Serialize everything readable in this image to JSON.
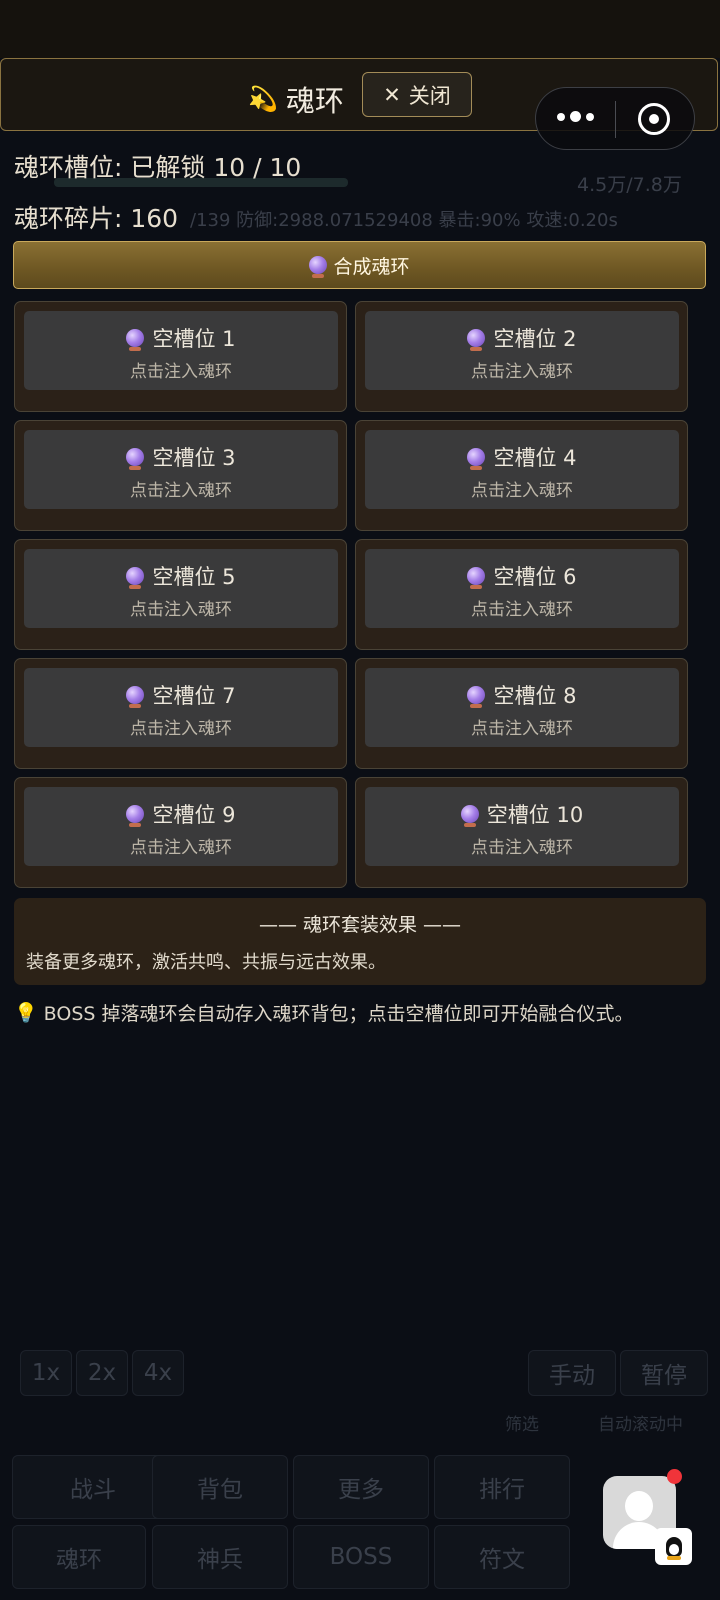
{
  "modal": {
    "title_icon": "shooting-star-icon",
    "title": "魂环",
    "close_label": "关闭"
  },
  "stats": {
    "slots_label": "魂环槽位: 已解锁 10 / 10",
    "fragments_label": "魂环碎片: 160"
  },
  "synth_button": {
    "icon": "crystal-ball-icon",
    "label": "合成魂环"
  },
  "slots": [
    {
      "title": "空槽位 1",
      "hint": "点击注入魂环"
    },
    {
      "title": "空槽位 2",
      "hint": "点击注入魂环"
    },
    {
      "title": "空槽位 3",
      "hint": "点击注入魂环"
    },
    {
      "title": "空槽位 4",
      "hint": "点击注入魂环"
    },
    {
      "title": "空槽位 5",
      "hint": "点击注入魂环"
    },
    {
      "title": "空槽位 6",
      "hint": "点击注入魂环"
    },
    {
      "title": "空槽位 7",
      "hint": "点击注入魂环"
    },
    {
      "title": "空槽位 8",
      "hint": "点击注入魂环"
    },
    {
      "title": "空槽位 9",
      "hint": "点击注入魂环"
    },
    {
      "title": "空槽位 10",
      "hint": "点击注入魂环"
    }
  ],
  "set_effect": {
    "title": "—— 魂环套装效果 ——",
    "description": "装备更多魂环，激活共鸣、共振与远古效果。"
  },
  "tip": "BOSS 掉落魂环会自动存入魂环背包；点击空槽位即可开始融合仪式。",
  "background": {
    "stats_line1": "4.5万/7.8万",
    "stats_line2": "/139  防御:2988.071529408  暴击:90%  攻速:0.20s",
    "speed_options": [
      "1x",
      "2x",
      "4x"
    ],
    "manual_label": "手动",
    "pause_label": "暂停",
    "filter_label": "筛选",
    "autoscroll_label": "自动滚动中",
    "nav_row1": [
      "战斗",
      "背包",
      "更多",
      "排行"
    ],
    "nav_row2": [
      "魂环",
      "神兵",
      "BOSS",
      "符文"
    ]
  },
  "colors": {
    "accent_gold": "#c9a95c",
    "panel_brown": "#2b2118",
    "slot_gray": "#3a3a3b",
    "page_bg": "#0b0e15"
  }
}
